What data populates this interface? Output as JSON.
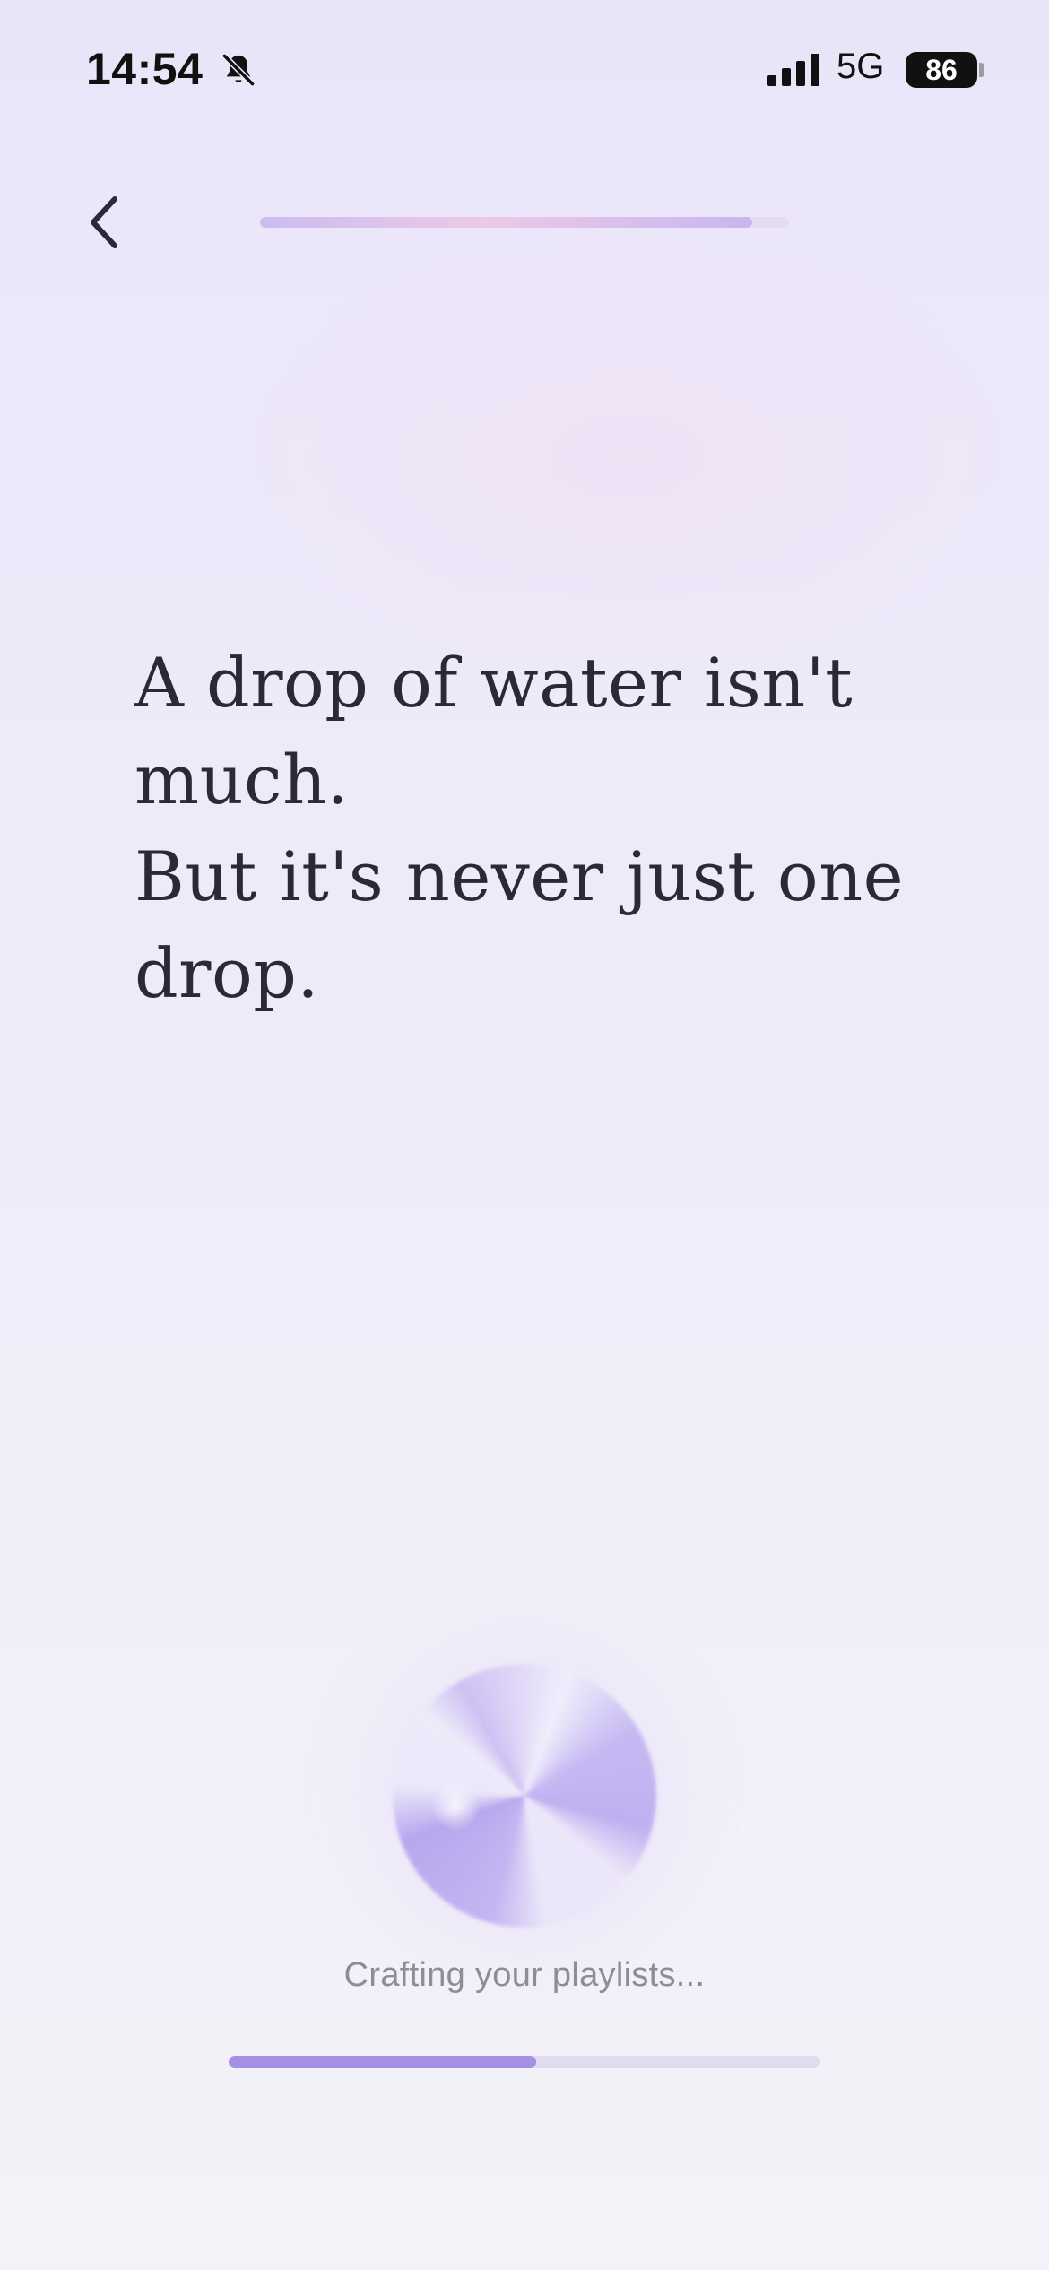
{
  "status_bar": {
    "time": "14:54",
    "network": "5G",
    "battery": "86",
    "silent_icon": "bell-slash-icon",
    "signal_icon": "cellular-signal-icon"
  },
  "nav": {
    "back_icon": "chevron-left-icon",
    "step_progress": 0.93
  },
  "quote": {
    "lines": [
      "A drop of water isn't",
      "much.",
      "But it's never just one",
      "drop."
    ]
  },
  "loading": {
    "status_text": "Crafting your playlists...",
    "progress": 0.52
  },
  "colors": {
    "accent": "#a48fe4",
    "text": "#2c2838",
    "muted_text": "#8e8c98"
  }
}
